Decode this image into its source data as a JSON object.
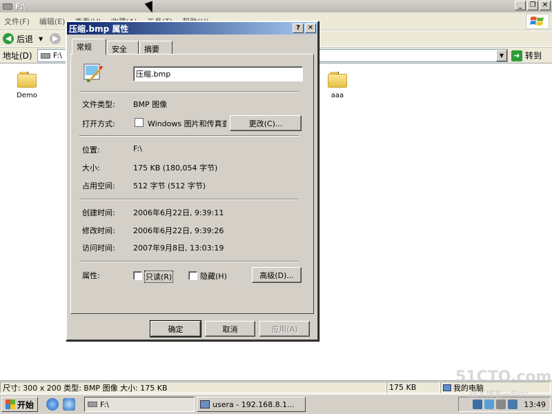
{
  "window": {
    "title": "F:\\"
  },
  "menu": [
    "文件(F)",
    "编辑(E)",
    "查看(V)",
    "收藏(A)",
    "工具(T)",
    "帮助(H)"
  ],
  "toolbar": {
    "back_label": "后退"
  },
  "address": {
    "label": "地址(D)",
    "value": "F:\\",
    "go_label": "转到"
  },
  "folders": [
    {
      "name": "Demo"
    },
    {
      "name": "aaa"
    }
  ],
  "dialog": {
    "title": "压缩.bmp 属性",
    "tabs": [
      "常规",
      "安全",
      "摘要"
    ],
    "filename": "压缩.bmp",
    "type_label": "文件类型:",
    "type_value": "BMP 图像",
    "opens_with_label": "打开方式:",
    "opens_with_value": "Windows 图片和传真查看器",
    "change_button": "更改(C)...",
    "location_label": "位置:",
    "location_value": "F:\\",
    "size_label": "大小:",
    "size_value": "175 KB (180,054 字节)",
    "size_on_disk_label": "占用空间:",
    "size_on_disk_value": "512 字节 (512 字节)",
    "created_label": "创建时间:",
    "created_value": "2006年6月22日, 9:39:11",
    "modified_label": "修改时间:",
    "modified_value": "2006年6月22日, 9:39:26",
    "accessed_label": "访问时间:",
    "accessed_value": "2007年9月8日, 13:03:19",
    "attributes_label": "属性:",
    "readonly_label": "只读(R)",
    "hidden_label": "隐藏(H)",
    "advanced_button": "高级(D)...",
    "ok_button": "确定",
    "cancel_button": "取消",
    "apply_button": "应用(A)"
  },
  "status": {
    "info": "尺寸: 300 x 200 类型: BMP 图像 大小: 175 KB",
    "size": "175 KB",
    "zone": "我的电脑"
  },
  "taskbar": {
    "start_label": "开始",
    "tasks": [
      "F:\\",
      "usera - 192.168.8.1..."
    ],
    "clock": "13:49"
  },
  "watermark": {
    "main": "51CTO.com",
    "sub": "技术博客—Blog"
  },
  "colors": {
    "title_active": "#0a246a",
    "face": "#d4d0c8",
    "accent_green": "#2e9c3a"
  }
}
